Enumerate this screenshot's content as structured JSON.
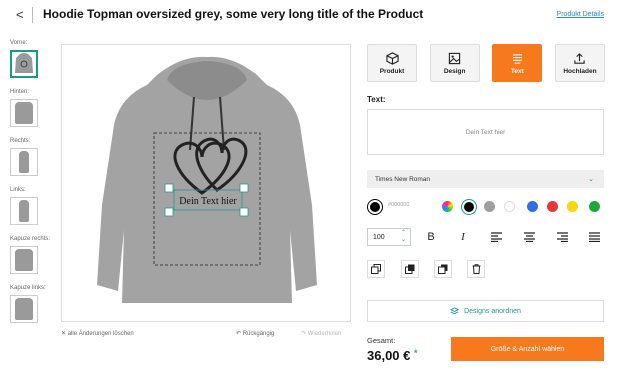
{
  "header": {
    "back_glyph": "<",
    "title": "Hoodie Topman oversized grey, some very long title of the Product",
    "details_link": "Produkt Details"
  },
  "views": [
    {
      "label": "Vorne:",
      "active": true
    },
    {
      "label": "Hinten:",
      "active": false
    },
    {
      "label": "Rechts:",
      "active": false
    },
    {
      "label": "Links:",
      "active": false
    },
    {
      "label": "Kapuze rechts:",
      "active": false
    },
    {
      "label": "Kapuze links:",
      "active": false
    }
  ],
  "design": {
    "text": "Dein Text hier"
  },
  "canvas_actions": {
    "clear": "alle Änderungen löschen",
    "undo": "Rückgängig",
    "redo": "Wiederholen"
  },
  "tabs": [
    {
      "label": "Produkt",
      "icon": "cube-icon"
    },
    {
      "label": "Design",
      "icon": "image-icon"
    },
    {
      "label": "Text",
      "icon": "text-lines-icon",
      "active": true
    },
    {
      "label": "Hochladen",
      "icon": "upload-icon"
    }
  ],
  "text_panel": {
    "label": "Text:",
    "placeholder": "Dein Text hier",
    "font": "Times New Roman",
    "current_color_hex": "#000000",
    "font_size": "100"
  },
  "colors": {
    "accent": "#f7791e",
    "teal": "#1a9a8a",
    "palette": [
      "#000000",
      "#9e9e9e",
      "#ffffff",
      "#2f6fe0",
      "#e53935",
      "#f5d90a",
      "#1fa83a"
    ]
  },
  "arrange_label": "Designs anordnen",
  "total": {
    "label": "Gesamt:",
    "price": "36,00 €",
    "star": "*"
  },
  "cta_label": "Größe & Anzahl wählen"
}
